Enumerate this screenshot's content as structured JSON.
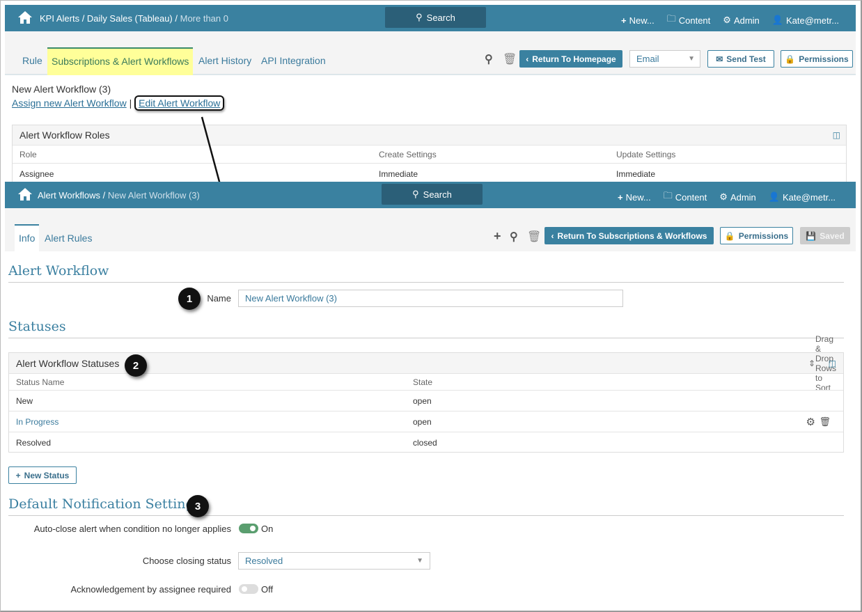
{
  "top": {
    "breadcrumb": [
      "KPI Alerts",
      "Daily Sales (Tableau)",
      "More than 0"
    ],
    "search": "Search",
    "nav": {
      "new": "New...",
      "content": "Content",
      "admin": "Admin",
      "user": "Kate@metr..."
    },
    "tabs": [
      "Rule",
      "Subscriptions & Alert Workflows",
      "Alert History",
      "API Integration"
    ],
    "active_tab": "Subscriptions & Alert Workflows",
    "return_btn": "Return To Homepage",
    "channel_select": "Email",
    "send_test": "Send Test",
    "permissions": "Permissions",
    "workflow_name": "New Alert Workflow (3)",
    "assign_link": "Assign new Alert Workflow",
    "separator": "|",
    "edit_link": "Edit Alert Workflow",
    "roles_table": {
      "title": "Alert Workflow Roles",
      "columns": [
        "Role",
        "Create Settings",
        "Update Settings"
      ],
      "rows": [
        [
          "Assignee",
          "Immediate",
          "Immediate"
        ]
      ]
    }
  },
  "bottom": {
    "breadcrumb": [
      "Alert Workflows",
      "New Alert Workflow (3)"
    ],
    "search": "Search",
    "nav": {
      "new": "New...",
      "content": "Content",
      "admin": "Admin",
      "user": "Kate@metr..."
    },
    "tabs": [
      "Info",
      "Alert Rules"
    ],
    "return_btn": "Return To Subscriptions & Workflows",
    "permissions": "Permissions",
    "saved": "Saved",
    "section_workflow": "Alert Workflow",
    "name_label": "Name",
    "name_value": "New Alert Workflow (3)",
    "section_statuses": "Statuses",
    "statuses_table": {
      "title": "Alert Workflow Statuses",
      "sort_hint": "Drag & Drop Rows to Sort",
      "columns": [
        "Status Name",
        "State"
      ],
      "rows": [
        [
          "New",
          "open"
        ],
        [
          "In Progress",
          "open"
        ],
        [
          "Resolved",
          "closed"
        ]
      ]
    },
    "new_status": "New Status",
    "section_notifications": "Default Notification Settings",
    "autoclose_label": "Auto-close alert when condition no longer applies",
    "autoclose_state": "On",
    "closing_label": "Choose closing status",
    "closing_value": "Resolved",
    "ack_label": "Acknowledgement by assignee required",
    "ack_state": "Off"
  },
  "badges": [
    "1",
    "2",
    "3"
  ],
  "colors": {
    "header": "#3a81a0",
    "active_tab": "#ffff99",
    "toggle_on": "#5a9e6f"
  }
}
